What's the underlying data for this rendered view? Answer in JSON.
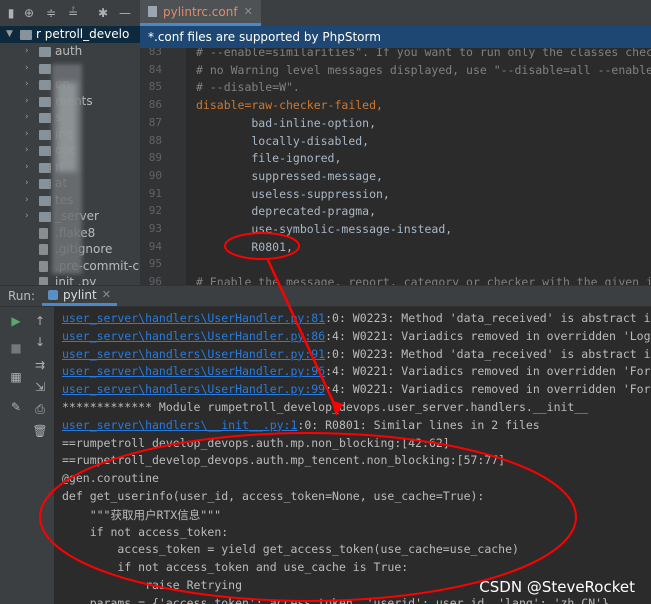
{
  "editor": {
    "tab_name": "pylintrc.conf",
    "tab_close": "✕",
    "banner": "*.conf files are supported by PhpStorm",
    "lines": [
      {
        "n": "83",
        "text": "# --enable=similarities\". If you want to run only the classes checker",
        "cls": "comment"
      },
      {
        "n": "84",
        "text": "# no Warning level messages displayed, use \"--disable=all --enable=cl",
        "cls": "comment"
      },
      {
        "n": "85",
        "text": "# --disable=W\".",
        "cls": "comment"
      },
      {
        "n": "86",
        "text": "disable=raw-checker-failed,",
        "cls": "key"
      },
      {
        "n": "87",
        "text": "        bad-inline-option,",
        "cls": ""
      },
      {
        "n": "88",
        "text": "        locally-disabled,",
        "cls": ""
      },
      {
        "n": "89",
        "text": "        file-ignored,",
        "cls": ""
      },
      {
        "n": "90",
        "text": "        suppressed-message,",
        "cls": ""
      },
      {
        "n": "91",
        "text": "        useless-suppression,",
        "cls": ""
      },
      {
        "n": "92",
        "text": "        deprecated-pragma,",
        "cls": ""
      },
      {
        "n": "93",
        "text": "        use-symbolic-message-instead,",
        "cls": ""
      },
      {
        "n": "94",
        "text": "        R0801,",
        "cls": ""
      },
      {
        "n": "95",
        "text": "",
        "cls": ""
      },
      {
        "n": "96",
        "text": "# Enable the message, report, category or checker with the given id(s",
        "cls": "comment"
      }
    ]
  },
  "project": {
    "root_label": "r   petroll_develo",
    "items": [
      {
        "label": "auth",
        "arrow": "›",
        "type": "folder"
      },
      {
        "label": "",
        "arrow": "›",
        "type": "folder"
      },
      {
        "label": "on",
        "arrow": "›",
        "type": "folder"
      },
      {
        "label": "ments",
        "arrow": "›",
        "type": "folder"
      },
      {
        "label": "s",
        "arrow": "›",
        "type": "folder"
      },
      {
        "label": "ing",
        "arrow": "›",
        "type": "folder"
      },
      {
        "label": "ooc",
        "arrow": "›",
        "type": "folder"
      },
      {
        "label": "ri",
        "arrow": "›",
        "type": "folder"
      },
      {
        "label": "at",
        "arrow": "›",
        "type": "folder"
      },
      {
        "label": "tes",
        "arrow": "›",
        "type": "folder"
      },
      {
        "label": "_server",
        "arrow": "›",
        "type": "folder"
      },
      {
        "label": ".flake8",
        "arrow": "",
        "type": "file"
      },
      {
        "label": ".gitignore",
        "arrow": "",
        "type": "file"
      },
      {
        "label": ".pre-commit-cor",
        "arrow": "",
        "type": "file"
      },
      {
        "label": "init  .py",
        "arrow": "",
        "type": "file"
      }
    ]
  },
  "run": {
    "label": "Run:",
    "tab_name": "pylint",
    "tab_close": "✕"
  },
  "console": {
    "lines": [
      {
        "link": "user_server\\handlers\\UserHandler.py:81",
        "rest": ":0: W0223: Method 'data_received' is abstract in cl"
      },
      {
        "link": "user_server\\handlers\\UserHandler.py:86",
        "rest": ":4: W0221: Variadics removed in overridden 'LogoutH"
      },
      {
        "link": "user_server\\handlers\\UserHandler.py:91",
        "rest": ":0: W0223: Method 'data_received' is abstract in cl"
      },
      {
        "link": "user_server\\handlers\\UserHandler.py:96",
        "rest": ":4: W0221: Variadics removed in overridden 'ForgetH"
      },
      {
        "link": "user_server\\handlers\\UserHandler.py:99",
        "rest": ":4: W0221: Variadics removed in overridden 'ForgetH"
      },
      {
        "link": "",
        "rest": "************* Module rumpetroll_develop_devops.user_server.handlers.__init__"
      },
      {
        "link": "user_server\\handlers\\__init__.py:1",
        "rest": ":0: R0801: Similar lines in 2 files"
      },
      {
        "link": "",
        "rest": "==rumpetroll_develop_devops.auth.mp.non_blocking:[42:62]"
      },
      {
        "link": "",
        "rest": "==rumpetroll_develop_devops.auth.mp_tencent.non_blocking:[57:77]"
      },
      {
        "link": "",
        "rest": "@gen.coroutine"
      },
      {
        "link": "",
        "rest": "def get_userinfo(user_id, access_token=None, use_cache=True):"
      },
      {
        "link": "",
        "rest": "    \"\"\"获取用户RTX信息\"\"\""
      },
      {
        "link": "",
        "rest": "    if not access_token:"
      },
      {
        "link": "",
        "rest": "        access_token = yield get_access_token(use_cache=use_cache)"
      },
      {
        "link": "",
        "rest": "        if not access_token and use_cache is True:"
      },
      {
        "link": "",
        "rest": "            raise Retrying"
      },
      {
        "link": "",
        "rest": "    params = {'access_token': access_token, 'userid': user_id, 'lang': 'zh_CN'}"
      }
    ]
  },
  "watermark": "CSDN @SteveRocket",
  "colors": {
    "annotation": "#ff0000",
    "link": "#287bde",
    "accent": "#4a88c7"
  }
}
